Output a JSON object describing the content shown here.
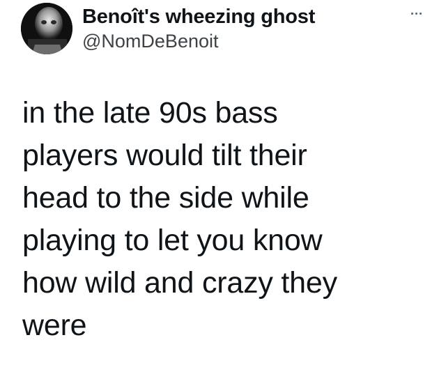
{
  "tweet": {
    "display_name": "Benoît's wheezing ghost",
    "handle": "@NomDeBenoit",
    "text": "in the late 90s bass\nplayers would tilt their\nhead to the side while\nplaying to let you know\nhow wild and crazy they\nwere",
    "more_icon": "more-horizontal-icon"
  }
}
